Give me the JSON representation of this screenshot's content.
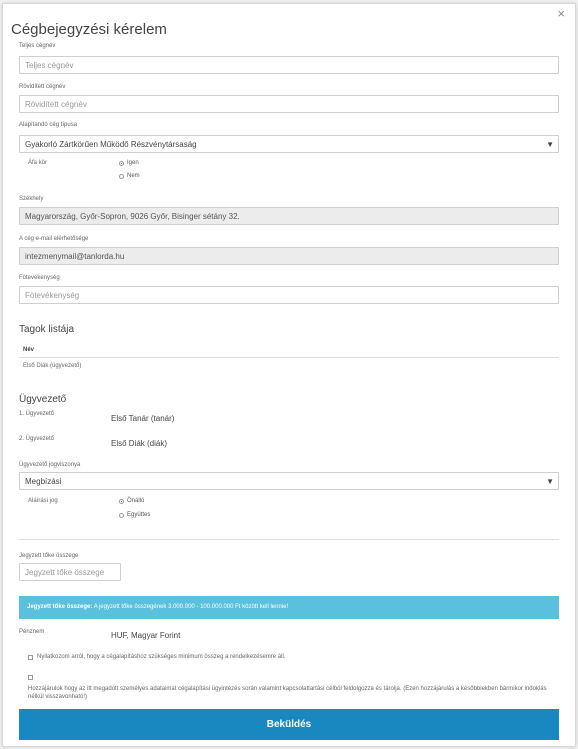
{
  "modal": {
    "title": "Cégbejegyzési kérelem",
    "close": "×"
  },
  "form": {
    "full_name": {
      "label": "Teljes cégnév",
      "placeholder": "Teljes cégnév"
    },
    "short_name": {
      "label": "Rövidített cégnév",
      "placeholder": "Rövidített cégnév"
    },
    "company_type": {
      "label": "Alapítandó cég típusa",
      "value": "Gyakorló Zártkörűen Működő Részvénytársaság"
    },
    "afa": {
      "label": "Áfa kör",
      "options": [
        "Igen",
        "Nem"
      ],
      "selected": "Igen"
    },
    "seat": {
      "label": "Székhely",
      "value": "Magyarország, Győr-Sopron, 9026 Győr, Bisinger sétány 32."
    },
    "email": {
      "label": "A cég e-mail elérhetősége",
      "value": "intezmenymail@tanlorda.hu"
    },
    "main_activity": {
      "label": "Fötevékenység",
      "placeholder": "Fötevékenység"
    },
    "members": {
      "title": "Tagok listája",
      "header": "Név",
      "rows": [
        "Első Diák (ügyvezető)"
      ]
    },
    "managers": {
      "title": "Ügyvezető",
      "items": [
        {
          "label": "1. Ügyvezető",
          "value": "Első Tanár (tanár)"
        },
        {
          "label": "2. Ügyvezető",
          "value": "Első Diák (diák)"
        }
      ]
    },
    "manager_legal": {
      "label": "Ügyvezető jogviszonya",
      "value": "Megbízási"
    },
    "signature": {
      "label": "Aláírási jog",
      "options": [
        "Önálló",
        "Együttes"
      ],
      "selected": "Önálló"
    },
    "capital": {
      "label": "Jegyzett tőke összege",
      "placeholder": "Jegyzett tőke összege"
    },
    "info": {
      "bold": "Jegyzett tőke összege:",
      "text": " A jegyzett tőke összegének 3.000.000 - 100.000.000 Ft között kell lennie!"
    },
    "currency": {
      "label": "Pénznem",
      "value": "HUF, Magyar Forint"
    },
    "consent1": "Nyilatkozom arról, hogy a cégalapításhoz szükséges minimum összeg a rendelkezésemre áll.",
    "consent2": "Hozzájárulok hogy az itt megadott személyes adataimat cégalapítási ügyintézés során valamint kapcsolattartási célból feldolgozza és tárolja. (Ezen hozzájárulás a későbbiekben bármikor indoklás nélkül visszavonható!)",
    "submit": "Beküldés"
  }
}
